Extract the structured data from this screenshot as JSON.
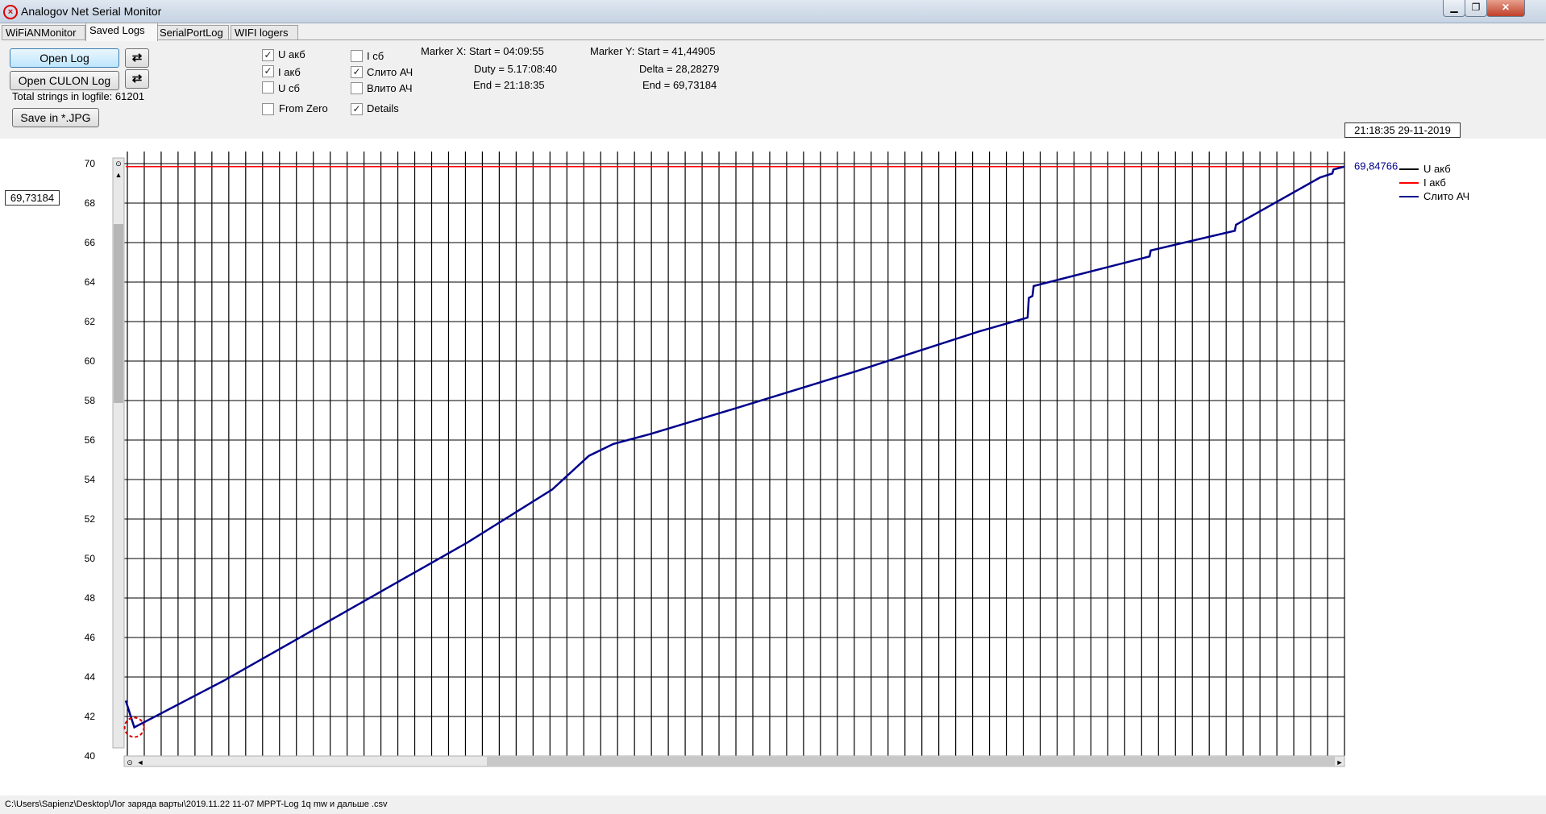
{
  "window": {
    "title": "Analogov Net Serial Monitor",
    "min_icon": "minimize-icon",
    "max_icon": "maximize-icon",
    "close_icon": "close-icon"
  },
  "tabs": [
    "WiFiANMonitor",
    "Saved Logs",
    "SerialPortLog",
    "WIFI logers"
  ],
  "active_tab": "Saved Logs",
  "toolbar": {
    "open_log": "Open Log",
    "open_culon_log": "Open CULON Log",
    "total_strings": "Total strings in logfile: 61201",
    "save_jpg": "Save in *.JPG",
    "refresh_icon": "refresh-icon"
  },
  "checkboxes": [
    {
      "label": "U акб",
      "checked": true
    },
    {
      "label": "I акб",
      "checked": true
    },
    {
      "label": "U сб",
      "checked": false
    },
    {
      "label": "From Zero",
      "checked": false
    },
    {
      "label": "I сб",
      "checked": false
    },
    {
      "label": "Слито АЧ",
      "checked": true
    },
    {
      "label": "Влито АЧ",
      "checked": false
    },
    {
      "label": "Details",
      "checked": true
    }
  ],
  "marker_x": {
    "start": "Marker X: Start = 04:09:55",
    "duty": "Duty = 5.17:08:40",
    "end": "End  = 21:18:35"
  },
  "marker_y": {
    "start": "Marker Y: Start = 41,44905",
    "delta": "Delta = 28,28279",
    "end": "End  = 69,73184"
  },
  "datetime": "21:18:35 29-11-2019",
  "cursor_value": "69,73184",
  "chart_data": {
    "type": "line",
    "ylim": [
      40,
      70
    ],
    "yticks": [
      40,
      42,
      44,
      46,
      48,
      50,
      52,
      54,
      56,
      58,
      60,
      62,
      64,
      66,
      68,
      70
    ],
    "xlim": [
      0,
      100
    ],
    "end_label": "69,84766",
    "legend": [
      {
        "name": "U акб",
        "color": "#000000"
      },
      {
        "name": "I акб",
        "color": "#ff0000"
      },
      {
        "name": "Слито АЧ",
        "color": "#00008b"
      }
    ],
    "series": [
      {
        "name": "I акб",
        "color": "#ff0000",
        "points": [
          [
            0,
            69.85
          ],
          [
            100,
            69.85
          ]
        ]
      },
      {
        "name": "Слито АЧ",
        "color": "#00008b",
        "points": [
          [
            0,
            42.8
          ],
          [
            0.7,
            41.45
          ],
          [
            8,
            43.8
          ],
          [
            18,
            47.3
          ],
          [
            28,
            50.8
          ],
          [
            35,
            53.5
          ],
          [
            38,
            55.2
          ],
          [
            40,
            55.8
          ],
          [
            43,
            56.3
          ],
          [
            50,
            57.6
          ],
          [
            60,
            59.5
          ],
          [
            70,
            61.5
          ],
          [
            74,
            62.2
          ],
          [
            74.1,
            63.2
          ],
          [
            74.4,
            63.3
          ],
          [
            74.5,
            63.8
          ],
          [
            84,
            65.3
          ],
          [
            84.1,
            65.6
          ],
          [
            91,
            66.6
          ],
          [
            91.1,
            66.9
          ],
          [
            98,
            69.3
          ],
          [
            99,
            69.5
          ],
          [
            99.1,
            69.7
          ],
          [
            100,
            69.85
          ]
        ]
      }
    ]
  },
  "status_path": "C:\\Users\\Sapienz\\Desktop\\Лог заряда варты\\2019.11.22 11-07 MPPT-Log 1q mw и дальше .csv"
}
